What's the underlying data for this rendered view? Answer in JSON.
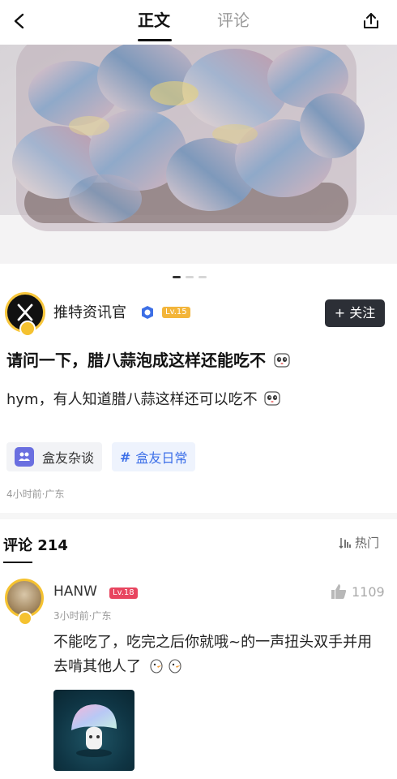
{
  "nav": {
    "tab_main": "正文",
    "tab_comments": "评论",
    "back_icon": "chevron-left-icon",
    "share_icon": "share-icon"
  },
  "carousel": {
    "pages": 3,
    "active_index": 0
  },
  "author": {
    "name": "推特资讯官",
    "level": "Lv.15",
    "follow_label": "+ 关注"
  },
  "post": {
    "title": "请问一下，腊八蒜泡成这样还能吃不",
    "body": "hym，有人知道腊八蒜这样还可以吃不",
    "tags": [
      "盒友杂谈",
      "盒友日常"
    ],
    "tag_hash": "#",
    "meta": "4小时前·广东"
  },
  "comments": {
    "title": "评论 214",
    "sort_label": "热门",
    "items": [
      {
        "name": "HANW",
        "level": "Lv.18",
        "likes": "1109",
        "meta": "3小时前·广东",
        "text": "不能吃了，吃完之后你就哦~的一声扭头双手并用去啃其他人了"
      }
    ]
  },
  "colors": {
    "follow_bg": "#2c2f36",
    "level_author": "#f3b53a",
    "level_commenter": "#e8455f",
    "tag_blue": "#3c6fe8"
  }
}
